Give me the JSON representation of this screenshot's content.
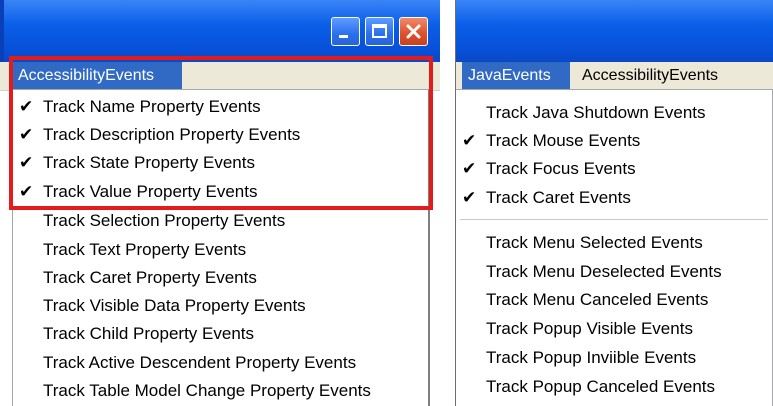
{
  "left": {
    "menu": [
      {
        "label": "AccessibilityEvents",
        "active": true
      }
    ],
    "items": [
      {
        "label": "Track Name Property Events",
        "checked": true
      },
      {
        "label": "Track Description Property Events",
        "checked": true
      },
      {
        "label": "Track State Property Events",
        "checked": true
      },
      {
        "label": "Track Value Property Events",
        "checked": true
      },
      {
        "label": "Track Selection Property Events",
        "checked": false
      },
      {
        "label": "Track Text Property Events",
        "checked": false
      },
      {
        "label": "Track Caret Property Events",
        "checked": false
      },
      {
        "label": "Track Visible Data Property Events",
        "checked": false
      },
      {
        "label": "Track Child Property Events",
        "checked": false
      },
      {
        "label": "Track Active Descendent Property Events",
        "checked": false
      },
      {
        "label": "Track Table Model Change Property Events",
        "checked": false
      }
    ]
  },
  "right": {
    "menu": [
      {
        "label": "JavaEvents",
        "active": true
      },
      {
        "label": "AccessibilityEvents",
        "active": false
      }
    ],
    "items": [
      {
        "label": "Track Java Shutdown Events",
        "checked": false
      },
      {
        "label": "Track Mouse Events",
        "checked": true
      },
      {
        "label": "Track Focus Events",
        "checked": true
      },
      {
        "label": "Track Caret Events",
        "checked": true
      },
      {
        "label": "Track Menu Selected Events",
        "checked": false
      },
      {
        "label": "Track Menu Deselected Events",
        "checked": false
      },
      {
        "label": "Track Menu Canceled Events",
        "checked": false
      },
      {
        "label": "Track Popup Visible Events",
        "checked": false
      },
      {
        "label": "Track Popup Inviible Events",
        "checked": false
      },
      {
        "label": "Track Popup Canceled Events",
        "checked": false
      }
    ]
  },
  "icons": {
    "check": "✔",
    "minimize": "minimize-icon",
    "maximize": "maximize-icon",
    "close": "close-icon"
  },
  "colors": {
    "titlebar": "#0a5fe8",
    "menu_active": "#316ac5",
    "highlight": "#e31b1b"
  }
}
